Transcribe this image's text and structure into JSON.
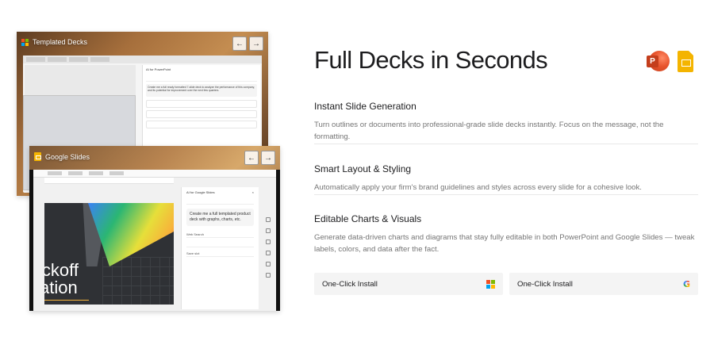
{
  "hero": {
    "title": "Full Decks in Seconds"
  },
  "app_icons": [
    "powerpoint-icon",
    "google-slides-icon"
  ],
  "features": [
    {
      "title": "Instant Slide Generation",
      "description": "Turn outlines or documents into professional-grade slide decks instantly. Focus on the message, not the formatting."
    },
    {
      "title": "Smart Layout & Styling",
      "description": "Automatically apply your firm's brand guidelines and styles across every slide for a cohesive look."
    },
    {
      "title": "Editable Charts & Visuals",
      "description": "Generate data-driven charts and diagrams that stay fully editable in both PowerPoint and Google Slides — tweak labels, colors, and data after the fact."
    }
  ],
  "install_buttons": [
    {
      "label": "One-Click Install",
      "icon": "microsoft-icon"
    },
    {
      "label": "One-Click Install",
      "icon": "google-icon"
    }
  ],
  "showcase": {
    "back_panel": {
      "title": "Templated Decks",
      "pane_header": "AI for PowerPoint",
      "prompt": "Create me a full ready formatted 7-slide deck to analyze the performance of this company, and its potential for improvement over the next few quarters."
    },
    "front_panel": {
      "title": "Google Slides",
      "pane_header": "AI for Google Slides",
      "prompt": "Create me a full templated product deck with graphs, charts, etc.",
      "slide_text_1": "ickoff",
      "slide_text_2": "ation",
      "pane_item_1": "Web Search",
      "pane_item_2": "Save slot"
    }
  },
  "colors": {
    "powerpoint": "#c43e1c",
    "google_slides": "#f4b400",
    "ms_red": "#f25022",
    "ms_green": "#7fba00",
    "ms_blue": "#00a4ef",
    "ms_yellow": "#ffb900",
    "text_primary": "#1d1d1f",
    "text_secondary": "#757575",
    "button_bg": "#f4f4f4"
  }
}
